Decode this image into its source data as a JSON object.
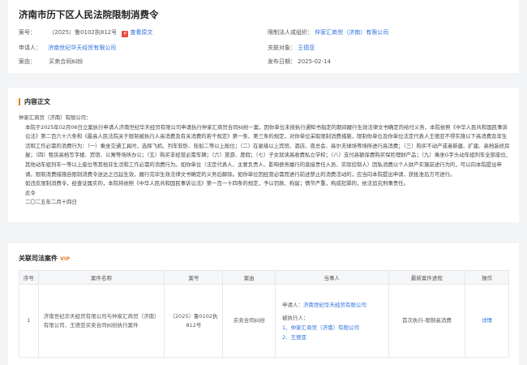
{
  "header": {
    "title": "济南市历下区人民法院限制消费令",
    "case_no_label": "案号：",
    "case_no": "（2025）鲁0102执812号",
    "pdf_icon": "pdf-icon",
    "view_original": "查看原文",
    "restricted_label": "限制法人或组织：",
    "restricted_org": "仲家汇商贸（济南）有限公司",
    "applicant_label": "申请人：",
    "applicant": "济南世纪华天经贸有限公司",
    "related_label": "关联对象：",
    "related": "王德亚",
    "case_cause_label": "案由：",
    "case_cause": "买卖合同纠纷",
    "date_label": "发布日期：",
    "date": "2025-02-14"
  },
  "body": {
    "section_title": "内容正文",
    "paragraphs": [
      "仲家汇商贸（济南）有限公司：",
      "本院于2025年02月06日立案执行申请人济南世纪华天经贸有限公司申请执行仲家汇商贸合同纠纷一案，因你单位未按执行通知书指定的期间履行生效法律文书确定的给付义务，本院依照《中华人民共和国民事诉讼法》第二百六十六条和《最高人民法院关于限制被执行人高消费及有关消费的若干规定》第一条、第三条的规定，对你单位采取限制消费措施，限制你单位及你单位法定代表人王德亚不得实施以下高消费及非生活和工作必需的消费行为：（一）乘坐交通工具时，选择飞机、列车软卧、轮船二等以上舱位；（二）在星级以上宾馆、酒店、夜总会、高尔夫球场等场所进行高消费；（三）购买不动产或者新建、扩建、高档装修房屋；（四）租赁高档写字楼、宾馆、公寓等场所办公；（五）购买非经营必需车辆；（六）旅游、度假；（七）子女就读高收费私立学校；（八）支付高额保费购买保险理财产品；（九）乘坐G字头动车组列车全部座位、其他动车组列车一等以上座位等其他非生活和工作必需的消费行为。如你单位（法定代表人、主要负责人、影响债务履行的直接责任人员、实际控制人）因私消费以个人财产实施前述行为的，可以向本院提出申请。限制消费措施自限制消费令送达之日起生效，履行完毕生效法律文书确定的义务后解除。如你单位因经营必需而进行前述禁止的消费活动的，应当向本院提出申请，获批准后方可进行。",
      "如违反限制消费令，经查证属实的，本院将依照《中华人民共和国民事诉讼法》第一百一十四条的规定，予以罚款、拘留；情节严重，构成犯罪的，依法追究刑事责任。",
      "此令",
      "二〇二五年二月十四日"
    ]
  },
  "cases": {
    "title": "关联司法案件",
    "vip": "VIP",
    "columns": [
      "序号",
      "案件名称",
      "案号",
      "案由",
      "当事人",
      "最新案件进程",
      "操作"
    ],
    "rows": [
      {
        "index": "1",
        "name": "济南世纪华天经贸有限公司与仲家汇商贸（济南）有限公司、王德亚买卖合同纠纷执行案件",
        "case_no": "（2025）鲁0102执812号",
        "cause": "买卖合同纠纷",
        "applicant_label": "申请人：",
        "applicant": "济南世纪华天经贸有限公司",
        "executed_label": "被执行人：",
        "executed_1": "1、仲家汇商贸（济南）有限公司",
        "executed_2": "2、王德亚",
        "progress": "首次执行-限制高消费",
        "action": "详情"
      }
    ]
  }
}
